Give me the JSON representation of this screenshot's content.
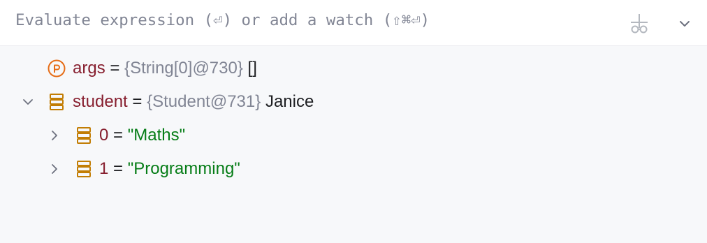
{
  "eval_bar": {
    "placeholder": "Evaluate expression (⏎) or add a watch (⇧⌘⏎)",
    "add_watch_icon": "add-watch-icon",
    "expand_icon": "chevron-down-icon"
  },
  "colors": {
    "var_name": "#871f2f",
    "type_hint": "#818594",
    "string_value": "#067d17",
    "parameter_icon": "#e66d17",
    "field_icon": "#c27d04"
  },
  "tree": {
    "rows": [
      {
        "name": "args",
        "eq": "=",
        "type": "{String[0]@730}",
        "value": "[]",
        "icon": "parameter-icon",
        "expanded": null
      },
      {
        "name": "student",
        "eq": "=",
        "type": "{Student@731}",
        "value": "Janice",
        "icon": "array-field-icon",
        "expanded": true
      },
      {
        "name": "0",
        "eq": "=",
        "value": "\"Maths\"",
        "icon": "array-field-icon",
        "expanded": false
      },
      {
        "name": "1",
        "eq": "=",
        "value": "\"Programming\"",
        "icon": "array-field-icon",
        "expanded": false
      }
    ]
  }
}
